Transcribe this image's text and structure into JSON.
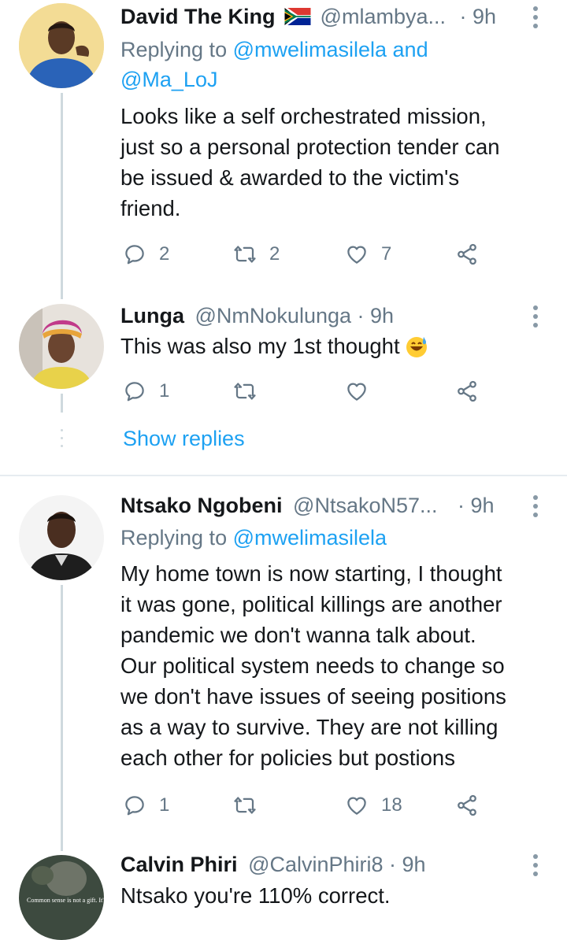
{
  "tweets": [
    {
      "name": "David The King",
      "handle": "@mlambya...",
      "time": "· 9h",
      "replying_prefix": "Replying to ",
      "replying_mentions": "@mwelimasilela and\n@Ma_LoJ",
      "text": "Looks like a self orchestrated mission,\njust so a personal protection tender can\nbe issued & awarded to the victim's\nfriend.",
      "replies": "2",
      "retweets": "2",
      "likes": "7"
    },
    {
      "name": "Lunga",
      "handle": "@NmNokulunga",
      "time": "· 9h",
      "text": "This was also my 1st thought",
      "replies": "1",
      "retweets": "",
      "likes": ""
    },
    {
      "name": "Ntsako Ngobeni",
      "handle": "@NtsakoN57...",
      "time": "· 9h",
      "replying_prefix": "Replying to ",
      "replying_mentions": "@mwelimasilela",
      "text": "My home town is now starting, I thought\nit was gone, political killings are another\npandemic we don't wanna talk about.\nOur political system needs to change so\nwe don't have issues of seeing positions\nas a way to survive. They are not killing\neach other for policies but postions",
      "replies": "1",
      "retweets": "",
      "likes": "18"
    },
    {
      "name": "Calvin Phiri",
      "handle": "@CalvinPhiri8",
      "time": "· 9h",
      "text": "Ntsako you're 110% correct."
    }
  ],
  "show_replies": "Show replies",
  "avatar4_text": "Common sense is not a gift. It's a punishment because you have to deal",
  "icons": {
    "reply": "reply-icon",
    "retweet": "retweet-icon",
    "like": "heart-icon",
    "share": "share-icon",
    "more": "more-vertical-icon",
    "flag": "south-africa-flag-icon",
    "emoji": "sweat-smile-emoji"
  },
  "colors": {
    "link": "#1da1f2",
    "muted": "#657786",
    "thread_line": "#cfd9de"
  }
}
